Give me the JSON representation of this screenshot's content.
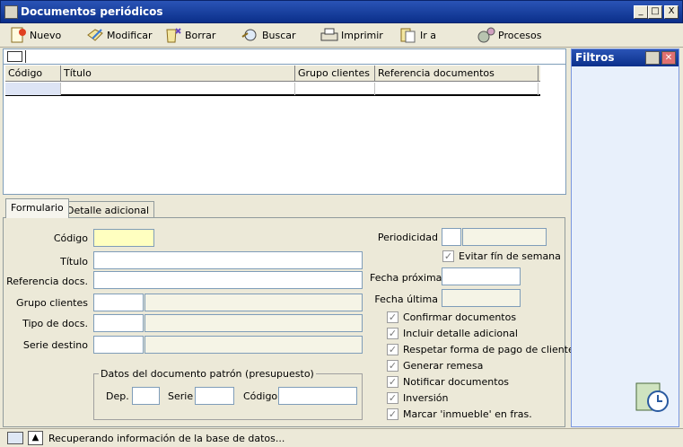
{
  "window": {
    "title": "Documentos periódicos",
    "min": "_",
    "max": "□",
    "close": "X"
  },
  "toolbar": {
    "nuevo": "Nuevo",
    "modificar": "Modificar",
    "borrar": "Borrar",
    "buscar": "Buscar",
    "imprimir": "Imprimir",
    "ira": "Ir a",
    "procesos": "Procesos"
  },
  "list": {
    "columns": [
      "Código",
      "Título",
      "Grupo clientes",
      "Referencia documentos"
    ]
  },
  "tabs": {
    "formulario": "Formulario",
    "detalle": "Detalle adicional"
  },
  "form": {
    "codigo": "Código",
    "titulo": "Título",
    "referencia": "Referencia docs.",
    "grupo": "Grupo clientes",
    "tipo": "Tipo de docs.",
    "serie": "Serie destino",
    "periodicidad": "Periodicidad",
    "evitar": "Evitar fín de semana",
    "fecha_proxima": "Fecha próxima",
    "fecha_ultima": "Fecha última",
    "checks": [
      "Confirmar documentos",
      "Incluir detalle adicional",
      "Respetar forma de pago de clientes",
      "Generar remesa",
      "Notificar documentos",
      "Inversión",
      "Marcar 'inmueble' en fras."
    ],
    "group_title": "Datos del documento patrón (presupuesto)",
    "dep": "Dep.",
    "serie2": "Serie",
    "codigo2": "Código"
  },
  "filtros": {
    "title": "Filtros"
  },
  "status": {
    "text": "Recuperando información de la base de datos..."
  },
  "colors": {
    "titlebar": "#0b2f8a",
    "required": "#ffffc0",
    "panel": "#ece9d8"
  }
}
